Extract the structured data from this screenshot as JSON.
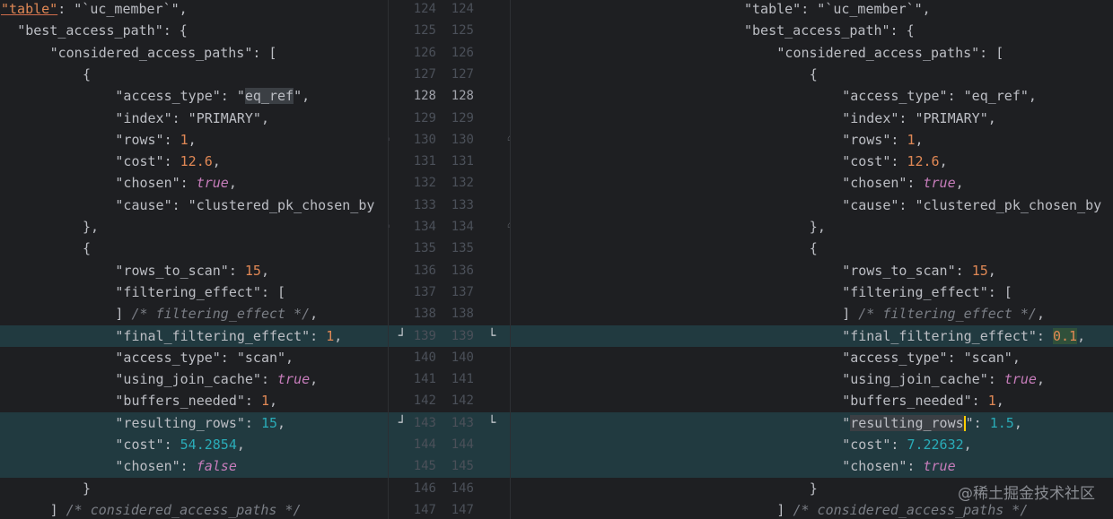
{
  "watermark": "@稀土掘金技术社区",
  "left": {
    "lines": [
      {
        "indent": 0,
        "parts": [
          {
            "t": "\"table\"",
            "c": "u-warn"
          },
          {
            "t": ": \"`uc_member`\",",
            "c": "str"
          }
        ]
      },
      {
        "indent": 1,
        "parts": [
          {
            "t": "\"best_access_path\": {",
            "c": "key"
          }
        ]
      },
      {
        "indent": 3,
        "parts": [
          {
            "t": "\"considered_access_paths\": [",
            "c": "key"
          }
        ]
      },
      {
        "indent": 5,
        "parts": [
          {
            "t": "{",
            "c": "punct"
          }
        ]
      },
      {
        "indent": 7,
        "parts": [
          {
            "t": "\"access_type\": \"",
            "c": "key"
          },
          {
            "t": "eq_ref",
            "c": "hl-word"
          },
          {
            "t": "\",",
            "c": "str"
          }
        ]
      },
      {
        "indent": 7,
        "parts": [
          {
            "t": "\"index\": \"PRIMARY\",",
            "c": "key"
          }
        ]
      },
      {
        "indent": 7,
        "parts": [
          {
            "t": "\"rows\": ",
            "c": "key"
          },
          {
            "t": "1",
            "c": "num orange"
          },
          {
            "t": ",",
            "c": "punct"
          }
        ]
      },
      {
        "indent": 7,
        "parts": [
          {
            "t": "\"cost\": ",
            "c": "key"
          },
          {
            "t": "12.6",
            "c": "num orange"
          },
          {
            "t": ",",
            "c": "punct"
          }
        ]
      },
      {
        "indent": 7,
        "parts": [
          {
            "t": "\"chosen\": ",
            "c": "key"
          },
          {
            "t": "true",
            "c": "bool"
          },
          {
            "t": ",",
            "c": "punct"
          }
        ]
      },
      {
        "indent": 7,
        "parts": [
          {
            "t": "\"cause\": \"clustered_pk_chosen_by",
            "c": "key"
          }
        ]
      },
      {
        "indent": 5,
        "parts": [
          {
            "t": "},",
            "c": "punct"
          }
        ]
      },
      {
        "indent": 5,
        "parts": [
          {
            "t": "{",
            "c": "punct"
          }
        ]
      },
      {
        "indent": 7,
        "parts": [
          {
            "t": "\"rows_to_scan\": ",
            "c": "key"
          },
          {
            "t": "15",
            "c": "num orange"
          },
          {
            "t": ",",
            "c": "punct"
          }
        ]
      },
      {
        "indent": 7,
        "parts": [
          {
            "t": "\"filtering_effect\": [",
            "c": "key"
          }
        ]
      },
      {
        "indent": 7,
        "parts": [
          {
            "t": "] ",
            "c": "punct"
          },
          {
            "t": "/* filtering_effect */",
            "c": "comment"
          },
          {
            "t": ",",
            "c": "punct"
          }
        ]
      },
      {
        "indent": 7,
        "changed": true,
        "parts": [
          {
            "t": "\"final_filtering_effect\": ",
            "c": "key"
          },
          {
            "t": "1",
            "c": "num orange"
          },
          {
            "t": ",",
            "c": "punct"
          }
        ]
      },
      {
        "indent": 7,
        "parts": [
          {
            "t": "\"access_type\": \"scan\",",
            "c": "key"
          }
        ]
      },
      {
        "indent": 7,
        "parts": [
          {
            "t": "\"using_join_cache\": ",
            "c": "key"
          },
          {
            "t": "true",
            "c": "bool"
          },
          {
            "t": ",",
            "c": "punct"
          }
        ]
      },
      {
        "indent": 7,
        "parts": [
          {
            "t": "\"buffers_needed\": ",
            "c": "key"
          },
          {
            "t": "1",
            "c": "num orange"
          },
          {
            "t": ",",
            "c": "punct"
          }
        ]
      },
      {
        "indent": 7,
        "changed": true,
        "parts": [
          {
            "t": "\"resulting_rows\": ",
            "c": "key"
          },
          {
            "t": "15",
            "c": "num"
          },
          {
            "t": ",",
            "c": "punct"
          }
        ]
      },
      {
        "indent": 7,
        "changed": true,
        "parts": [
          {
            "t": "\"cost\": ",
            "c": "key"
          },
          {
            "t": "54.2854",
            "c": "num"
          },
          {
            "t": ",",
            "c": "punct"
          }
        ]
      },
      {
        "indent": 7,
        "changed": true,
        "parts": [
          {
            "t": "\"chosen\": ",
            "c": "key"
          },
          {
            "t": "false",
            "c": "bool"
          }
        ]
      },
      {
        "indent": 5,
        "parts": [
          {
            "t": "}",
            "c": "punct"
          }
        ]
      },
      {
        "indent": 3,
        "parts": [
          {
            "t": "] ",
            "c": "punct"
          },
          {
            "t": "/* considered_access_paths */",
            "c": "comment"
          }
        ]
      }
    ]
  },
  "right": {
    "lines": [
      {
        "indent": 0,
        "parts": [
          {
            "t": "\"table\": \"`uc_member`\",",
            "c": "key"
          }
        ]
      },
      {
        "indent": 0,
        "parts": [
          {
            "t": "\"best_access_path\": {",
            "c": "key"
          }
        ]
      },
      {
        "indent": 2,
        "parts": [
          {
            "t": "\"considered_access_paths\": [",
            "c": "key"
          }
        ]
      },
      {
        "indent": 4,
        "parts": [
          {
            "t": "{",
            "c": "punct"
          }
        ]
      },
      {
        "indent": 6,
        "parts": [
          {
            "t": "\"access_type\": \"eq_ref\",",
            "c": "key"
          }
        ]
      },
      {
        "indent": 6,
        "parts": [
          {
            "t": "\"index\": \"PRIMARY\",",
            "c": "key"
          }
        ]
      },
      {
        "indent": 6,
        "parts": [
          {
            "t": "\"rows\": ",
            "c": "key"
          },
          {
            "t": "1",
            "c": "num orange"
          },
          {
            "t": ",",
            "c": "punct"
          }
        ]
      },
      {
        "indent": 6,
        "parts": [
          {
            "t": "\"cost\": ",
            "c": "key"
          },
          {
            "t": "12.6",
            "c": "num orange"
          },
          {
            "t": ",",
            "c": "punct"
          }
        ]
      },
      {
        "indent": 6,
        "parts": [
          {
            "t": "\"chosen\": ",
            "c": "key"
          },
          {
            "t": "true",
            "c": "bool"
          },
          {
            "t": ",",
            "c": "punct"
          }
        ]
      },
      {
        "indent": 6,
        "parts": [
          {
            "t": "\"cause\": \"clustered_pk_chosen_by",
            "c": "key"
          }
        ]
      },
      {
        "indent": 4,
        "parts": [
          {
            "t": "},",
            "c": "punct"
          }
        ]
      },
      {
        "indent": 4,
        "parts": [
          {
            "t": "{",
            "c": "punct"
          }
        ]
      },
      {
        "indent": 6,
        "parts": [
          {
            "t": "\"rows_to_scan\": ",
            "c": "key"
          },
          {
            "t": "15",
            "c": "num orange"
          },
          {
            "t": ",",
            "c": "punct"
          }
        ]
      },
      {
        "indent": 6,
        "parts": [
          {
            "t": "\"filtering_effect\": [",
            "c": "key"
          }
        ]
      },
      {
        "indent": 6,
        "parts": [
          {
            "t": "] ",
            "c": "punct"
          },
          {
            "t": "/* filtering_effect */",
            "c": "comment"
          },
          {
            "t": ",",
            "c": "punct"
          }
        ]
      },
      {
        "indent": 6,
        "changed": true,
        "parts": [
          {
            "t": "\"final_filtering_effect\": ",
            "c": "key"
          },
          {
            "t": "0.1",
            "c": "num orange hl-diff"
          },
          {
            "t": ",",
            "c": "punct"
          }
        ]
      },
      {
        "indent": 6,
        "parts": [
          {
            "t": "\"access_type\": \"scan\",",
            "c": "key"
          }
        ]
      },
      {
        "indent": 6,
        "parts": [
          {
            "t": "\"using_join_cache\": ",
            "c": "key"
          },
          {
            "t": "true",
            "c": "bool"
          },
          {
            "t": ",",
            "c": "punct"
          }
        ]
      },
      {
        "indent": 6,
        "parts": [
          {
            "t": "\"buffers_needed\": ",
            "c": "key"
          },
          {
            "t": "1",
            "c": "num orange"
          },
          {
            "t": ",",
            "c": "punct"
          }
        ]
      },
      {
        "indent": 6,
        "changed": true,
        "cursor": true,
        "parts": [
          {
            "t": "\"",
            "c": "key"
          },
          {
            "t": "resulting_rows",
            "c": "hl-word"
          },
          {
            "t": "|CURSOR|",
            "c": "cursor"
          },
          {
            "t": "\": ",
            "c": "key"
          },
          {
            "t": "1.5",
            "c": "num"
          },
          {
            "t": ",",
            "c": "punct"
          }
        ]
      },
      {
        "indent": 6,
        "changed": true,
        "parts": [
          {
            "t": "\"cost\": ",
            "c": "key"
          },
          {
            "t": "7.22632",
            "c": "num"
          },
          {
            "t": ",",
            "c": "punct"
          }
        ]
      },
      {
        "indent": 6,
        "changed": true,
        "parts": [
          {
            "t": "\"chosen\": ",
            "c": "key"
          },
          {
            "t": "true",
            "c": "bool"
          }
        ]
      },
      {
        "indent": 4,
        "parts": [
          {
            "t": "}",
            "c": "punct"
          }
        ]
      },
      {
        "indent": 2,
        "parts": [
          {
            "t": "] ",
            "c": "punct"
          },
          {
            "t": "/* considered_access_paths */",
            "c": "comment"
          }
        ]
      }
    ]
  },
  "gutter": {
    "left_numbers": [
      "124",
      "125",
      "126",
      "127",
      "128",
      "129",
      "130",
      "131",
      "132",
      "133",
      "134",
      "135",
      "136",
      "137",
      "138",
      "139",
      "140",
      "141",
      "142",
      "143",
      "144",
      "145",
      "146",
      "147"
    ],
    "right_numbers": [
      "124",
      "125",
      "126",
      "127",
      "128",
      "129",
      "130",
      "131",
      "132",
      "133",
      "134",
      "135",
      "136",
      "137",
      "138",
      "139",
      "140",
      "141",
      "142",
      "143",
      "144",
      "145",
      "146",
      "147"
    ],
    "current_line": "128",
    "fold_rows": [
      "130",
      "134"
    ],
    "merge_rows": [
      "139",
      "143"
    ],
    "merge_left_icon": "merge-left-icon",
    "merge_right_icon": "merge-right-icon",
    "fold_icon": "fold-marker-icon"
  }
}
